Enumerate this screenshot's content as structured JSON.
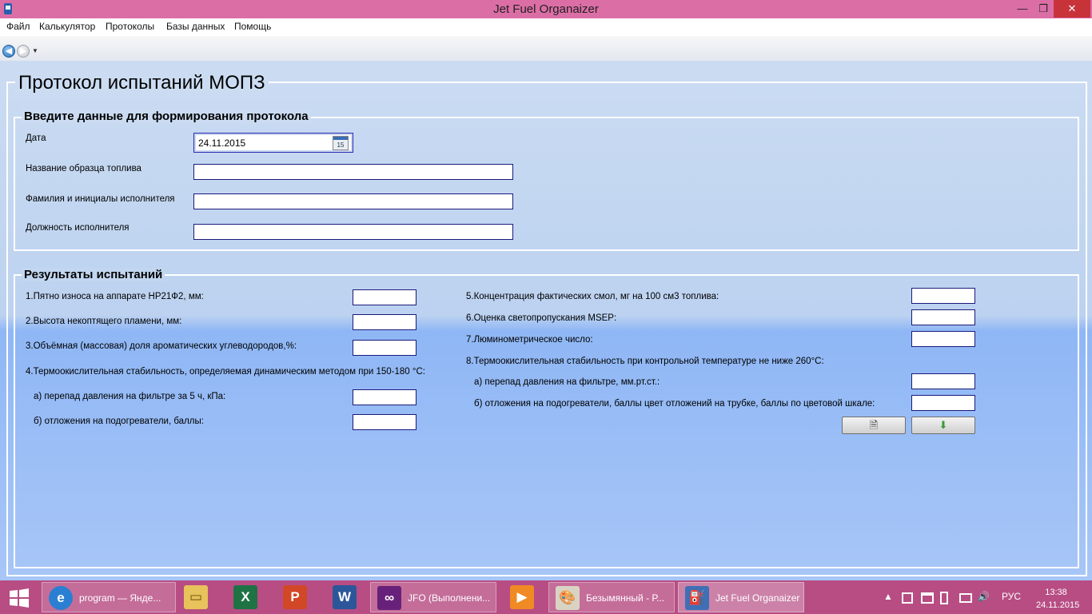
{
  "window": {
    "title": "Jet Fuel Organaizer",
    "minimize_glyph": "—",
    "maximize_glyph": "❐",
    "close_glyph": "✕"
  },
  "menu": [
    "Файл",
    "Калькулятор",
    "Протоколы",
    "Базы данных",
    "Помощь"
  ],
  "nav": {
    "back_icon": "back-arrow-icon",
    "forward_icon": "forward-arrow-icon",
    "back_glyph": "◀",
    "forward_glyph": "▶",
    "dropdown_glyph": "▼"
  },
  "page_title": "Протокол испытаний МОПЗ",
  "input_section": {
    "title": "Введите данные для формирования протокола",
    "date_label": "Дата",
    "date_value": "24.11.2015",
    "calendar_day": "15",
    "sample_label": "Название образца топлива",
    "sample_value": "",
    "executor_label": "Фамилия и инициалы исполнителя",
    "executor_value": "",
    "position_label": "Должность исполнителя",
    "position_value": ""
  },
  "results_section": {
    "title": "Результаты испытаний",
    "left": {
      "r1": "1.Пятно износа на аппарате НР21Ф2, мм:",
      "r2": "2.Высота некоптящего пламени, мм:",
      "r3": "3.Объёмная (массовая) доля ароматических углеводородов,%:",
      "r4": "4.Термоокислительная стабильность, определяемая динамическим методом при 150-180 °С:",
      "r4a": "а) перепад давления на фильтре за 5 ч, кПа:",
      "r4b": "б) отложения на подогреватели, баллы:"
    },
    "right": {
      "r5": "5.Концентрация фактических смол, мг на 100 см3 топлива:",
      "r6": "6.Оценка светопропускания MSEP:",
      "r7": "7.Люминометрическое число:",
      "r8": "8.Термоокислительная стабильность при контрольной температуре не ниже 260°С:",
      "r8a": "а) перепад давления на фильтре, мм.рт.ст.:",
      "r8b": "б) отложения на подогреватели, баллы цвет отложений на трубке, баллы по цветовой шкале:"
    },
    "buttons": {
      "document_icon": "document-icon",
      "save_icon": "download-icon",
      "document_glyph": "🗎",
      "save_glyph": "⬇"
    }
  },
  "taskbar": {
    "start_icon": "windows-logo-icon",
    "items": [
      {
        "label": "program — Янде...",
        "icon": "internet-explorer-icon",
        "glyph": "e"
      },
      {
        "label": "",
        "icon": "file-explorer-icon",
        "glyph": "▭"
      },
      {
        "label": "",
        "icon": "excel-icon",
        "glyph": "X"
      },
      {
        "label": "",
        "icon": "powerpoint-icon",
        "glyph": "P"
      },
      {
        "label": "",
        "icon": "word-icon",
        "glyph": "W"
      },
      {
        "label": "JFO (Выполнени...",
        "icon": "visual-studio-icon",
        "glyph": "∞"
      },
      {
        "label": "",
        "icon": "media-player-icon",
        "glyph": "▶"
      },
      {
        "label": "Безымянный - Р...",
        "icon": "paint-icon",
        "glyph": "🎨"
      },
      {
        "label": "Jet Fuel Organaizer",
        "icon": "jet-fuel-app-icon",
        "glyph": "⛽"
      }
    ],
    "tray": {
      "lang": "РУС",
      "time": "13:38",
      "date": "24.11.2015",
      "up_glyph": "▲",
      "volume_glyph": "🔊"
    }
  }
}
